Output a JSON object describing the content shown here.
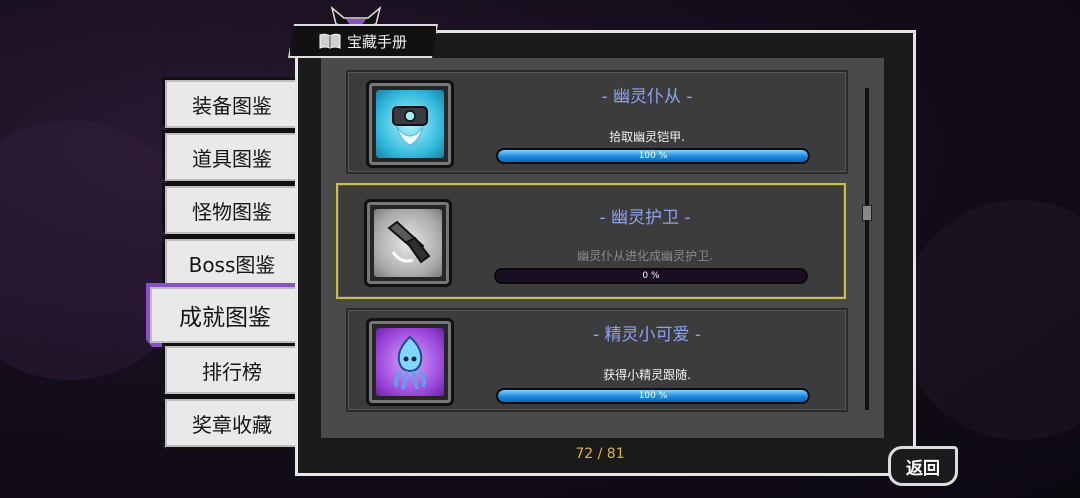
{
  "header": {
    "title": "宝藏手册",
    "icon": "book-icon"
  },
  "tabs": [
    {
      "label": "装备图鉴",
      "active": false
    },
    {
      "label": "道具图鉴",
      "active": false
    },
    {
      "label": "怪物图鉴",
      "active": false
    },
    {
      "label": "Boss图鉴",
      "active": false
    },
    {
      "label": "成就图鉴",
      "active": true
    },
    {
      "label": "排行榜",
      "active": false
    },
    {
      "label": "奖章收藏",
      "active": false
    }
  ],
  "achievements": [
    {
      "title": "- 幽灵仆从 -",
      "description": "拾取幽灵铠甲.",
      "progress_text": "100 %",
      "progress": 1.0,
      "icon": "ghost-armor-icon",
      "completed": true
    },
    {
      "title": "- 幽灵护卫 -",
      "description": "幽灵仆从进化成幽灵护卫.",
      "progress_text": "0 %",
      "progress": 0.0,
      "icon": "ghost-guard-icon",
      "completed": false,
      "selected": true
    },
    {
      "title": "- 精灵小可爱 -",
      "description": "获得小精灵跟随.",
      "progress_text": "100 %",
      "progress": 1.0,
      "icon": "sprite-icon",
      "completed": true
    }
  ],
  "pagination": {
    "count": "72 / 81"
  },
  "back_button": {
    "label": "返回"
  },
  "colors": {
    "accent_purple": "#8c4fc9",
    "title_blue": "#8ea2f0",
    "selected_border": "#c9c23a",
    "progress_blue": "#1a88e0",
    "page_gold": "#e0b33a"
  }
}
